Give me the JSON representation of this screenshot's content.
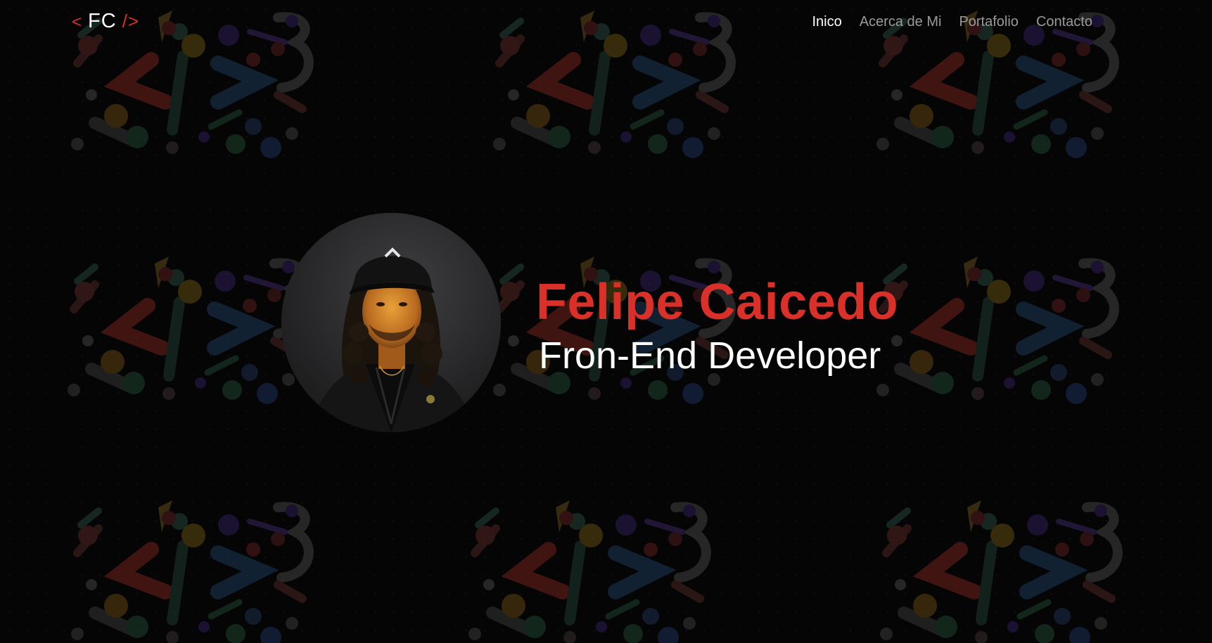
{
  "logo": {
    "open": "<",
    "initials": "FC",
    "close": "/>"
  },
  "nav": {
    "items": [
      {
        "label": "Inico",
        "active": true
      },
      {
        "label": "Acerca de Mi",
        "active": false
      },
      {
        "label": "Portafolio",
        "active": false
      },
      {
        "label": "Contacto",
        "active": false
      }
    ]
  },
  "hero": {
    "name": "Felipe Caicedo",
    "role": "Fron-End Developer"
  },
  "colors": {
    "background": "#050505",
    "accent": "#d9302a",
    "nav_active": "#ffffff",
    "nav_inactive": "#9a9a9a"
  },
  "icons": {
    "background_pattern": "code-brackets-pattern",
    "profile_photo": "avatar"
  }
}
